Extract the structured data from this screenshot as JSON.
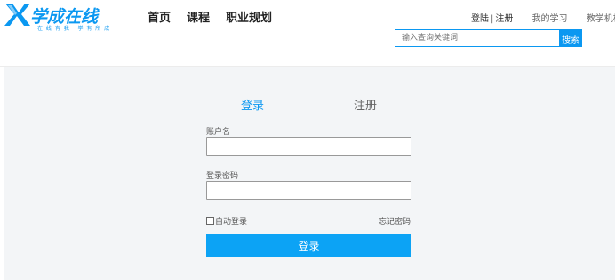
{
  "brand": {
    "name": "学成在线",
    "slogan": "在 线 有 我 · 学 有 所 成"
  },
  "nav": {
    "items": [
      {
        "label": "首页"
      },
      {
        "label": "课程"
      },
      {
        "label": "职业规划"
      }
    ]
  },
  "header_links": {
    "login": "登陆",
    "separator": "|",
    "register": "注册",
    "my_study": "我的学习",
    "teaching": "教学机构"
  },
  "search": {
    "placeholder": "输入查询关键词",
    "button_label": "搜索"
  },
  "auth": {
    "tab_login": "登录",
    "tab_register": "注册",
    "username_label": "账户名",
    "password_label": "登录密码",
    "remember_label": "自动登录",
    "forgot_label": "忘记密码",
    "submit_label": "登录"
  },
  "colors": {
    "accent": "#0b98f1",
    "panel_bg": "#f3f5f7"
  }
}
